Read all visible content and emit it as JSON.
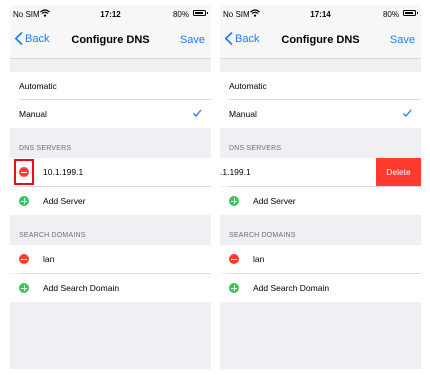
{
  "left": {
    "status": {
      "carrier": "No SIM",
      "time": "17:12",
      "battery": "80%"
    },
    "nav": {
      "back": "Back",
      "title": "Configure DNS",
      "save": "Save"
    },
    "mode": {
      "automatic": "Automatic",
      "manual": "Manual"
    },
    "dns_header": "DNS SERVERS",
    "dns_servers": [
      "10.1.199.1"
    ],
    "add_server": "Add Server",
    "search_header": "SEARCH DOMAINS",
    "search_domains": [
      "lan"
    ],
    "add_search_domain": "Add Search Domain"
  },
  "right": {
    "status": {
      "carrier": "No SIM",
      "time": "17:14",
      "battery": "80%"
    },
    "nav": {
      "back": "Back",
      "title": "Configure DNS",
      "save": "Save"
    },
    "mode": {
      "automatic": "Automatic",
      "manual": "Manual"
    },
    "dns_header": "DNS SERVERS",
    "dns_servers": [
      ".1.199.1"
    ],
    "delete_label": "Delete",
    "add_server": "Add Server",
    "search_header": "SEARCH DOMAINS",
    "search_domains": [
      "lan"
    ],
    "add_search_domain": "Add Search Domain"
  },
  "colors": {
    "accent": "#1a7cff",
    "delete": "#ff3b30",
    "add": "#34c759",
    "highlight": "#e3101c"
  }
}
